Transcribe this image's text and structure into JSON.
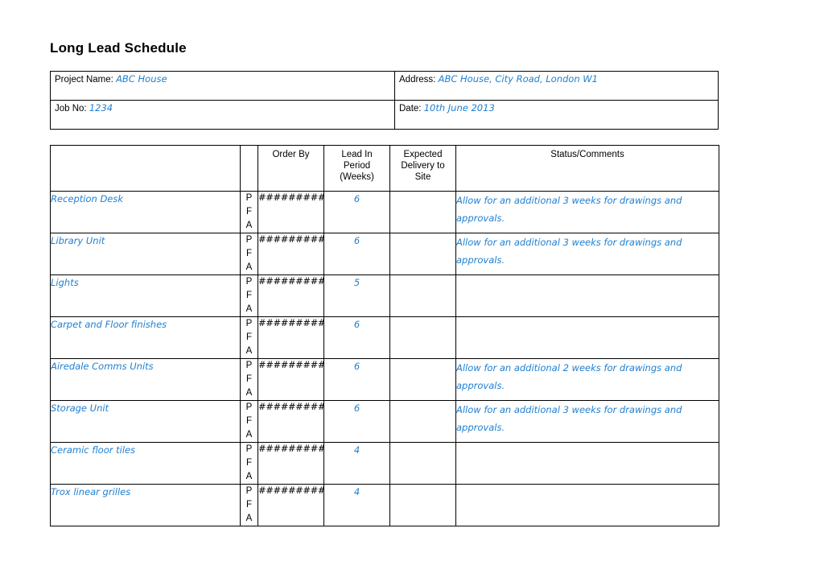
{
  "document": {
    "title": "Long Lead Schedule"
  },
  "colors": {
    "value_blue": "#1f7fd0",
    "border_black": "#000000",
    "page_background": "#ffffff"
  },
  "info": {
    "project_name_label": "Project Name:",
    "project_name_value": "ABC House",
    "address_label": "Address:",
    "address_value": "ABC House, City Road, London W1",
    "job_no_label": "Job No:",
    "job_no_value": "1234",
    "date_label": "Date:",
    "date_value": "10th June 2013"
  },
  "table": {
    "headers": {
      "item": "",
      "pfa": "",
      "order_by": "Order By",
      "lead_in_period": "Lead In Period (Weeks)",
      "lead_in_line1": "Lead In",
      "lead_in_line2": "Period",
      "lead_in_line3": "(Weeks)",
      "expected_delivery": "Expected Delivery to Site",
      "expected_line1": "Expected",
      "expected_line2": "Delivery to",
      "expected_line3": "Site",
      "status_comments": "Status/Comments"
    },
    "pfa_letters": {
      "p": "P",
      "f": "F",
      "a": "A"
    },
    "rows": [
      {
        "item": "Reception Desk",
        "pfa": [
          "P",
          "F",
          "A"
        ],
        "order_by": "##########",
        "lead_in_weeks": "6",
        "expected_delivery": "",
        "status_comments": "Allow for an additional 3 weeks for drawings and approvals."
      },
      {
        "item": "Library Unit",
        "pfa": [
          "P",
          "F",
          "A"
        ],
        "order_by": "##########",
        "lead_in_weeks": "6",
        "expected_delivery": "",
        "status_comments": "Allow for an additional 3 weeks for drawings and approvals."
      },
      {
        "item": "Lights",
        "pfa": [
          "P",
          "F",
          "A"
        ],
        "order_by": "##########",
        "lead_in_weeks": "5",
        "expected_delivery": "",
        "status_comments": ""
      },
      {
        "item": "Carpet and Floor finishes",
        "pfa": [
          "P",
          "F",
          "A"
        ],
        "order_by": "##########",
        "lead_in_weeks": "6",
        "expected_delivery": "",
        "status_comments": ""
      },
      {
        "item": "Airedale Comms Units",
        "pfa": [
          "P",
          "F",
          "A"
        ],
        "order_by": "##########",
        "lead_in_weeks": "6",
        "expected_delivery": "",
        "status_comments": "Allow for an additional 2 weeks for drawings and approvals."
      },
      {
        "item": "Storage Unit",
        "pfa": [
          "P",
          "F",
          "A"
        ],
        "order_by": "##########",
        "lead_in_weeks": "6",
        "expected_delivery": "",
        "status_comments": "Allow for an additional 3 weeks for drawings and approvals."
      },
      {
        "item": "Ceramic floor tiles",
        "pfa": [
          "P",
          "F",
          "A"
        ],
        "order_by": "##########",
        "lead_in_weeks": "4",
        "expected_delivery": "",
        "status_comments": ""
      },
      {
        "item": "Trox linear grilles",
        "pfa": [
          "P",
          "F",
          "A"
        ],
        "order_by": "##########",
        "lead_in_weeks": "4",
        "expected_delivery": "",
        "status_comments": ""
      }
    ]
  }
}
